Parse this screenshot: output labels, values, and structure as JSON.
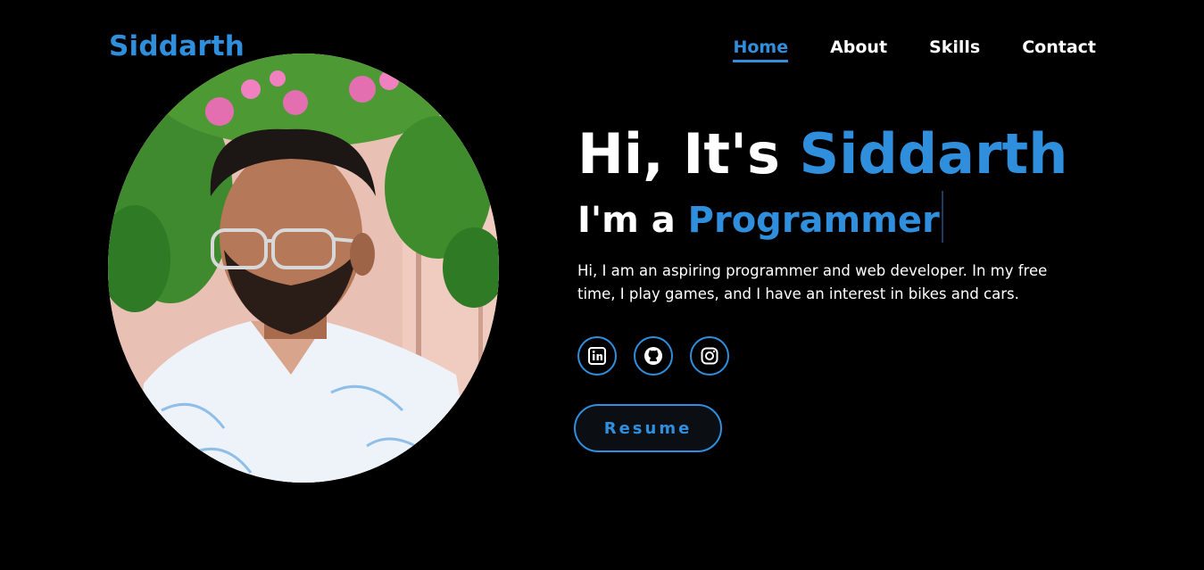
{
  "header": {
    "logo": "Siddarth",
    "nav": [
      {
        "label": "Home",
        "active": true
      },
      {
        "label": "About",
        "active": false
      },
      {
        "label": "Skills",
        "active": false
      },
      {
        "label": "Contact",
        "active": false
      }
    ]
  },
  "hero": {
    "greeting_prefix": "Hi, It's ",
    "greeting_name": "Siddarth",
    "role_prefix": "I'm a ",
    "role_title": "Programmer",
    "bio": "Hi, I am an aspiring programmer and web developer. In my free time, I play games, and I have an interest in bikes and cars.",
    "socials": [
      {
        "icon": "linkedin-icon"
      },
      {
        "icon": "github-icon"
      },
      {
        "icon": "instagram-icon"
      }
    ],
    "resume_label": "Resume"
  },
  "colors": {
    "accent": "#2f8fdc",
    "background": "#000000",
    "text": "#ffffff"
  }
}
